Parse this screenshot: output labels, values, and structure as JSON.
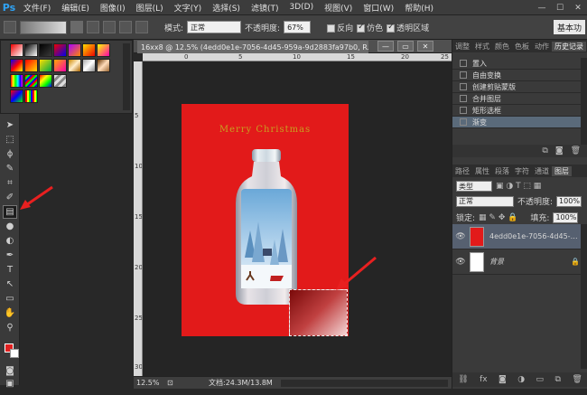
{
  "app": {
    "logo": "Ps"
  },
  "menubar": {
    "items": [
      "文件(F)",
      "编辑(E)",
      "图像(I)",
      "图层(L)",
      "文字(Y)",
      "选择(S)",
      "滤镜(T)",
      "3D(D)",
      "视图(V)",
      "窗口(W)",
      "帮助(H)"
    ]
  },
  "options": {
    "mode_label": "模式:",
    "mode_value": "正常",
    "opacity_label": "不透明度:",
    "opacity_value": "67%",
    "reverse_label": "反向",
    "dither_label": "仿色",
    "transparency_label": "透明区域",
    "workspace": "基本功"
  },
  "document": {
    "tab_title": "16xx8 @ 12.5% (4edd0e1e-7056-4d45-959a-9d2883fa97b0, R...",
    "zoom": "12.5%",
    "doc_info": "文档:24.3M/13.8M",
    "poster_text": "Merry Christmas",
    "ruler_top": [
      "0",
      "5",
      "10",
      "15",
      "20",
      "25"
    ],
    "ruler_left": [
      "5",
      "10",
      "15",
      "20",
      "25",
      "30"
    ]
  },
  "history": {
    "tabs": [
      "调整",
      "样式",
      "颜色",
      "色板",
      "动作",
      "历史记录"
    ],
    "items": [
      "置入",
      "自由变换",
      "创建剪贴蒙版",
      "合并图层",
      "矩形选框",
      "渐变"
    ]
  },
  "layers": {
    "tabs": [
      "路径",
      "属性",
      "段落",
      "字符",
      "通道",
      "图层"
    ],
    "kind_label": "类型",
    "blend_mode": "正常",
    "opacity_label": "不透明度:",
    "opacity_value": "100%",
    "lock_label": "锁定:",
    "fill_label": "填充:",
    "fill_value": "100%",
    "items": [
      {
        "name": "4edd0e1e-7056-4d45-959a-9d2883fa97b0"
      },
      {
        "name": "背景"
      }
    ]
  },
  "colors": {
    "accent_arrow": "#e82020",
    "foreground": "#e02020",
    "background": "#ffffff"
  }
}
